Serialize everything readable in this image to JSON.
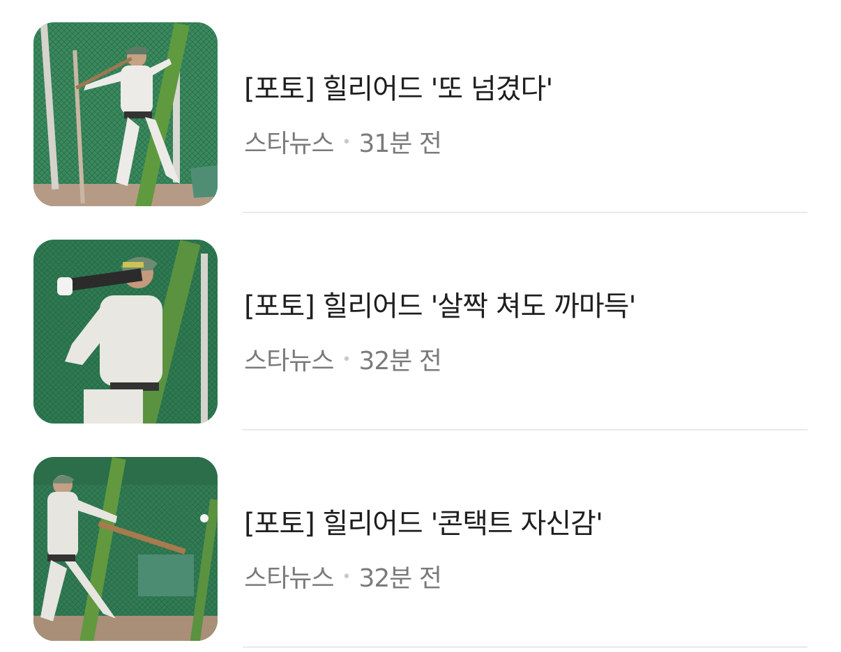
{
  "news": [
    {
      "title": "[포토] 힐리어드 '또 넘겼다'",
      "source": "스타뉴스",
      "time": "31분 전",
      "thumbnail_icon": "baseball-batter-photo"
    },
    {
      "title": "[포토] 힐리어드 '살짝 쳐도 까마득'",
      "source": "스타뉴스",
      "time": "32분 전",
      "thumbnail_icon": "baseball-batter-photo"
    },
    {
      "title": "[포토] 힐리어드 '콘택트 자신감'",
      "source": "스타뉴스",
      "time": "32분 전",
      "thumbnail_icon": "baseball-batter-photo"
    }
  ],
  "separator": "•",
  "colors": {
    "title": "#1e1e1e",
    "meta": "#7a7a7a",
    "divider": "#e9e9e9",
    "net_green": "#2f7a52"
  }
}
